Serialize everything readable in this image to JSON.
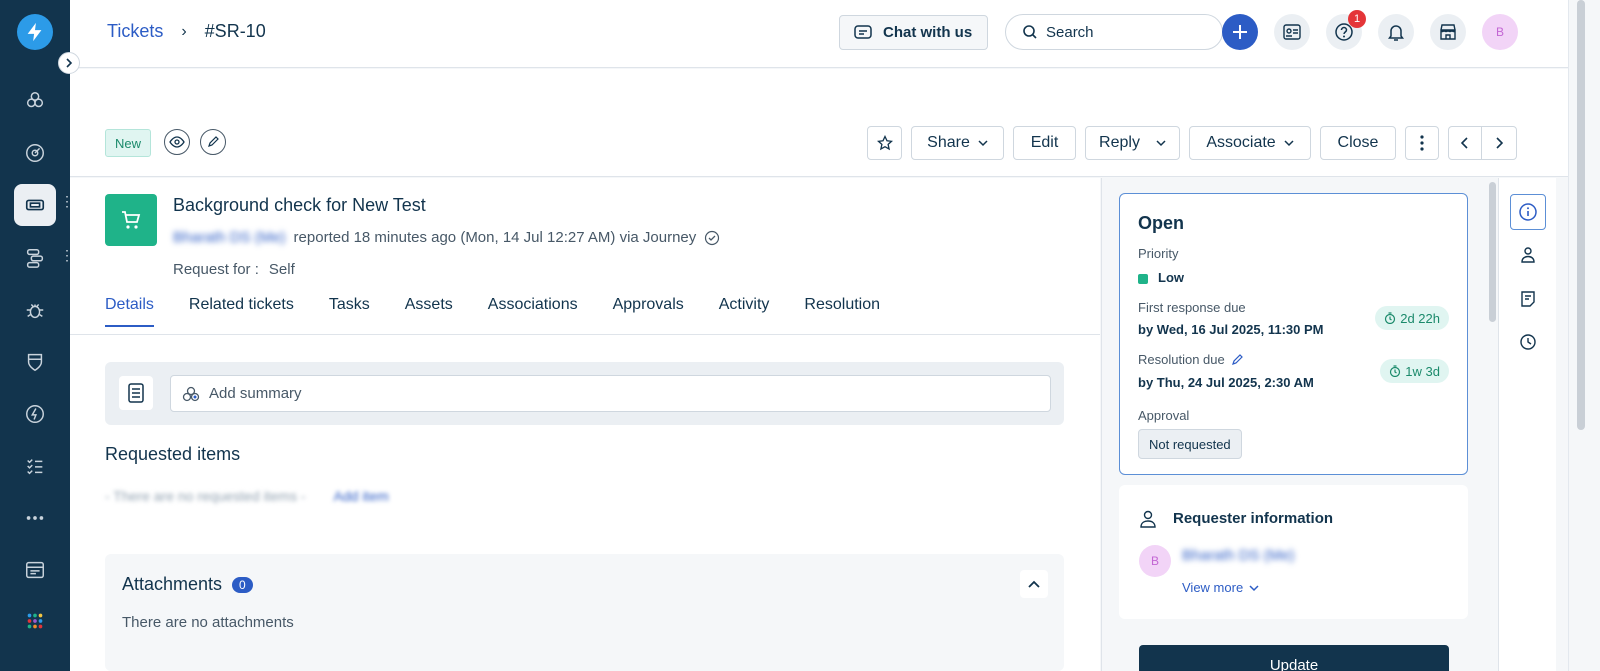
{
  "nav": {
    "items": [
      "home",
      "dashboard",
      "tickets",
      "workflows",
      "problems",
      "changes",
      "releases",
      "tasks",
      "more",
      "assets",
      "apps"
    ]
  },
  "header": {
    "breadcrumb_root": "Tickets",
    "breadcrumb_current": "#SR-10",
    "chat_label": "Chat with us",
    "search_placeholder": "Search",
    "notif_count": "1",
    "avatar_initial": "B"
  },
  "toolbar": {
    "status": "New",
    "share": "Share",
    "edit": "Edit",
    "reply": "Reply",
    "associate": "Associate",
    "close": "Close"
  },
  "ticket": {
    "title": "Background check for New Test",
    "requester": "Bharath DS (Me)",
    "meta": "reported 18 minutes ago (Mon, 14 Jul 12:27 AM) via Journey",
    "request_for_label": "Request for :",
    "request_for_value": "Self"
  },
  "tabs": [
    "Details",
    "Related tickets",
    "Tasks",
    "Assets",
    "Associations",
    "Approvals",
    "Activity",
    "Resolution"
  ],
  "summary": {
    "placeholder": "Add summary"
  },
  "requested_items": {
    "title": "Requested items",
    "empty": "- There are no requested items -",
    "add": "Add item"
  },
  "attachments": {
    "title": "Attachments",
    "count": "0",
    "empty": "There are no attachments"
  },
  "status_card": {
    "title": "Open",
    "priority_label": "Priority",
    "priority_value": "Low",
    "first_response_label": "First response due",
    "first_response_value": "by Wed, 16 Jul 2025, 11:30 PM",
    "first_response_sla": "2d 22h",
    "resolution_label": "Resolution due",
    "resolution_value": "by Thu, 24 Jul 2025, 2:30 AM",
    "resolution_sla": "1w 3d",
    "approval_label": "Approval",
    "approval_value": "Not requested"
  },
  "requester_card": {
    "title": "Requester information",
    "avatar_initial": "B",
    "name": "Bharath DS (Me)",
    "view_more": "View more"
  },
  "update_button": "Update",
  "colors": {
    "nav_bg": "#12344d",
    "accent": "#2c5cc5",
    "success": "#1fb389"
  }
}
